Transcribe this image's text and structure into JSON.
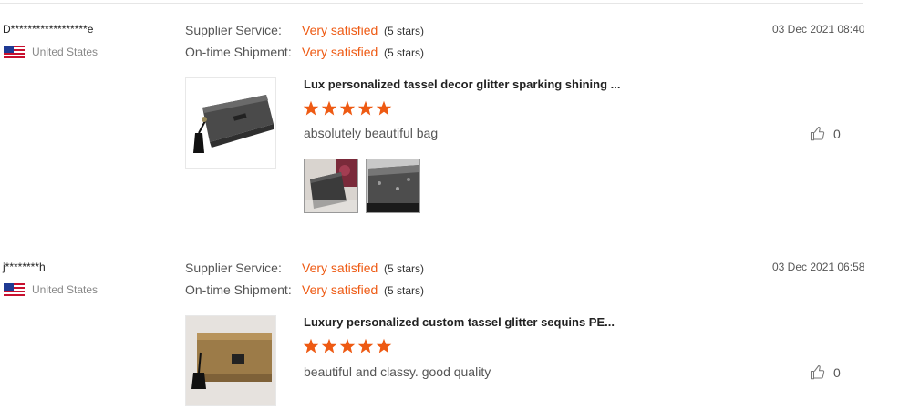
{
  "colors": {
    "accent": "#ee5a13",
    "separator": "#e6e6e6"
  },
  "reviews": [
    {
      "buyer": "D******************e",
      "country": "United States",
      "ratings": [
        {
          "label": "Supplier Service:",
          "value": "Very satisfied",
          "stars": "(5 stars)"
        },
        {
          "label": "On-time Shipment:",
          "value": "Very satisfied",
          "stars": "(5 stars)"
        }
      ],
      "date": "03 Dec 2021 08:40",
      "product_title": "Lux personalized tassel decor glitter sparking shining ...",
      "star_rating": 5,
      "comment": "absolutely beautiful bag",
      "helpful_count": "0"
    },
    {
      "buyer": "j********h",
      "country": "United States",
      "ratings": [
        {
          "label": "Supplier Service:",
          "value": "Very satisfied",
          "stars": "(5 stars)"
        },
        {
          "label": "On-time Shipment:",
          "value": "Very satisfied",
          "stars": "(5 stars)"
        }
      ],
      "date": "03 Dec 2021 06:58",
      "product_title": "Luxury personalized custom tassel glitter sequins PE...",
      "star_rating": 5,
      "comment": "beautiful and classy. good quality",
      "helpful_count": "0"
    }
  ]
}
